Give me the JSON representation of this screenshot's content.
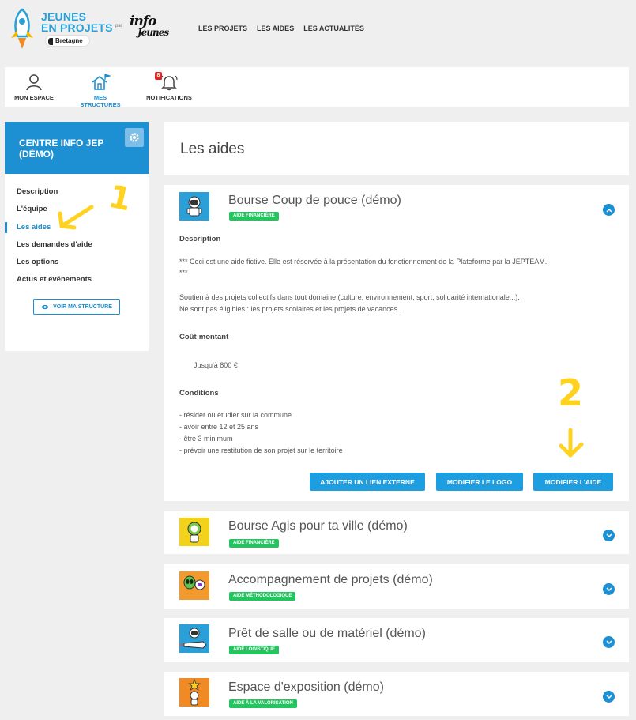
{
  "header": {
    "brand_line1": "JEUNES",
    "brand_line2": "EN PROJETS",
    "region": "Bretagne",
    "par": "par",
    "partner_line1": "info",
    "partner_line2": "Jeunes",
    "nav": [
      "LES PROJETS",
      "LES AIDES",
      "LES ACTUALITÉS"
    ]
  },
  "toolbar": {
    "items": [
      {
        "label": "MON ESPACE",
        "icon": "user-icon"
      },
      {
        "label": "MES STRUCTURES",
        "icon": "home-flag-icon"
      },
      {
        "label": "NOTIFICATIONS",
        "icon": "bell-icon",
        "badge": "8"
      }
    ]
  },
  "sidebar": {
    "title": "CENTRE INFO JEP (DÉMO)",
    "items": [
      "Description",
      "L'équipe",
      "Les aides",
      "Les demandes d'aide",
      "Les options",
      "Actus et événements"
    ],
    "active": "Les aides",
    "view_button": "VOIR MA STRUCTURE"
  },
  "main": {
    "title": "Les aides",
    "expanded": {
      "name": "Bourse Coup de pouce (démo)",
      "tag": "AIDE FINANCIÈRE",
      "description_heading": "Description",
      "description_p1a": "*** Ceci est une aide fictive. Elle est réservée à la présentation du fonctionnement de la Plateforme par la JEPTEAM.",
      "description_p1b": "***",
      "description_p2a": "Soutien à des projets collectifs dans tout domaine (culture, environnement, sport, solidarité internationale...).",
      "description_p2b": "Ne sont pas éligibles : les projets scolaires et les projets de vacances.",
      "cost_heading": "Coût-montant",
      "cost_value": "Jusqu'à 800 €",
      "conditions_heading": "Conditions",
      "conditions": [
        "- résider ou étudier sur la commune",
        "- avoir entre 12 et 25 ans",
        "- être 3 minimum",
        "- prévoir une restitution de son projet sur le territoire"
      ],
      "buttons": [
        "AJOUTER UN LIEN EXTERNE",
        "MODIFIER LE LOGO",
        "MODIFIER L'AIDE"
      ]
    },
    "aids": [
      {
        "name": "Bourse Agis pour ta ville (démo)",
        "tag": "AIDE FINANCIÈRE",
        "thumb_color": "#f3d21c"
      },
      {
        "name": "Accompagnement de projets (démo)",
        "tag": "AIDE MÉTHODOLOGIQUE",
        "thumb_color": "#f29a2e"
      },
      {
        "name": "Prêt de salle ou de matériel (démo)",
        "tag": "AIDE LOGISTIQUE",
        "thumb_color": "#2a9fd8"
      },
      {
        "name": "Espace d'exposition (démo)",
        "tag": "AIDE À LA VALORISATION",
        "thumb_color": "#f08a24"
      }
    ]
  },
  "annotations": [
    "1",
    "2"
  ],
  "colors": {
    "accent": "#1d8fd3",
    "tag": "#22c55e",
    "annotation": "#ffd21f"
  }
}
